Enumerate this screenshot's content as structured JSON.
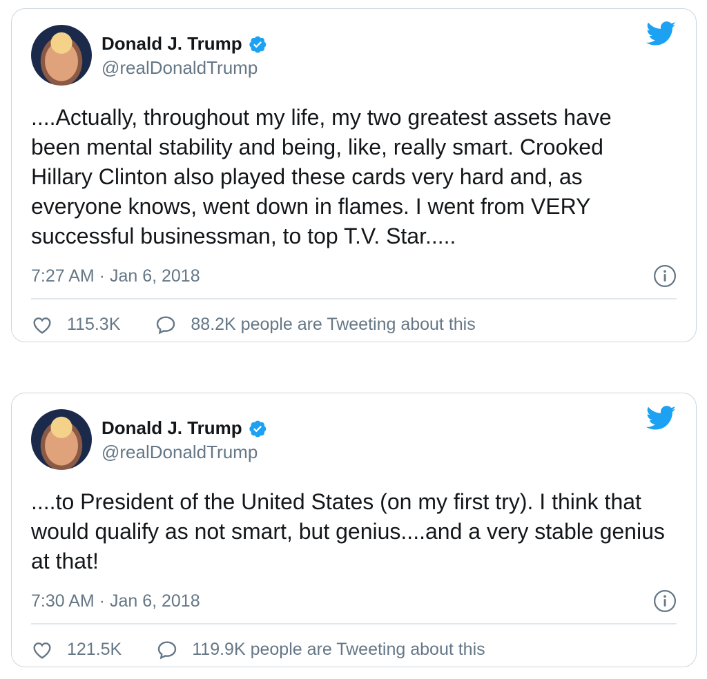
{
  "tweets": [
    {
      "author": {
        "name": "Donald J. Trump",
        "handle": "@realDonaldTrump"
      },
      "text": "....Actually, throughout my life, my two greatest assets have been mental stability and being, like, really smart. Crooked Hillary Clinton also played these cards very hard and, as everyone knows, went down in flames. I went from VERY successful businessman, to top T.V. Star.....",
      "timestamp": "7:27 AM · Jan 6, 2018",
      "likes": "115.3K",
      "tweeting": "88.2K people are Tweeting about this"
    },
    {
      "author": {
        "name": "Donald J. Trump",
        "handle": "@realDonaldTrump"
      },
      "text": "....to President of the United States (on my first try). I think that would qualify as not smart, but genius....and a very stable genius at that!",
      "timestamp": "7:30 AM · Jan 6, 2018",
      "likes": "121.5K",
      "tweeting": "119.9K people are Tweeting about this"
    }
  ],
  "colors": {
    "accent": "#1da1f2",
    "muted": "#657786",
    "border": "#ccd6dd"
  },
  "icons": [
    "verified-badge-icon",
    "twitter-bird-icon",
    "info-icon",
    "heart-icon",
    "speech-bubble-icon"
  ]
}
